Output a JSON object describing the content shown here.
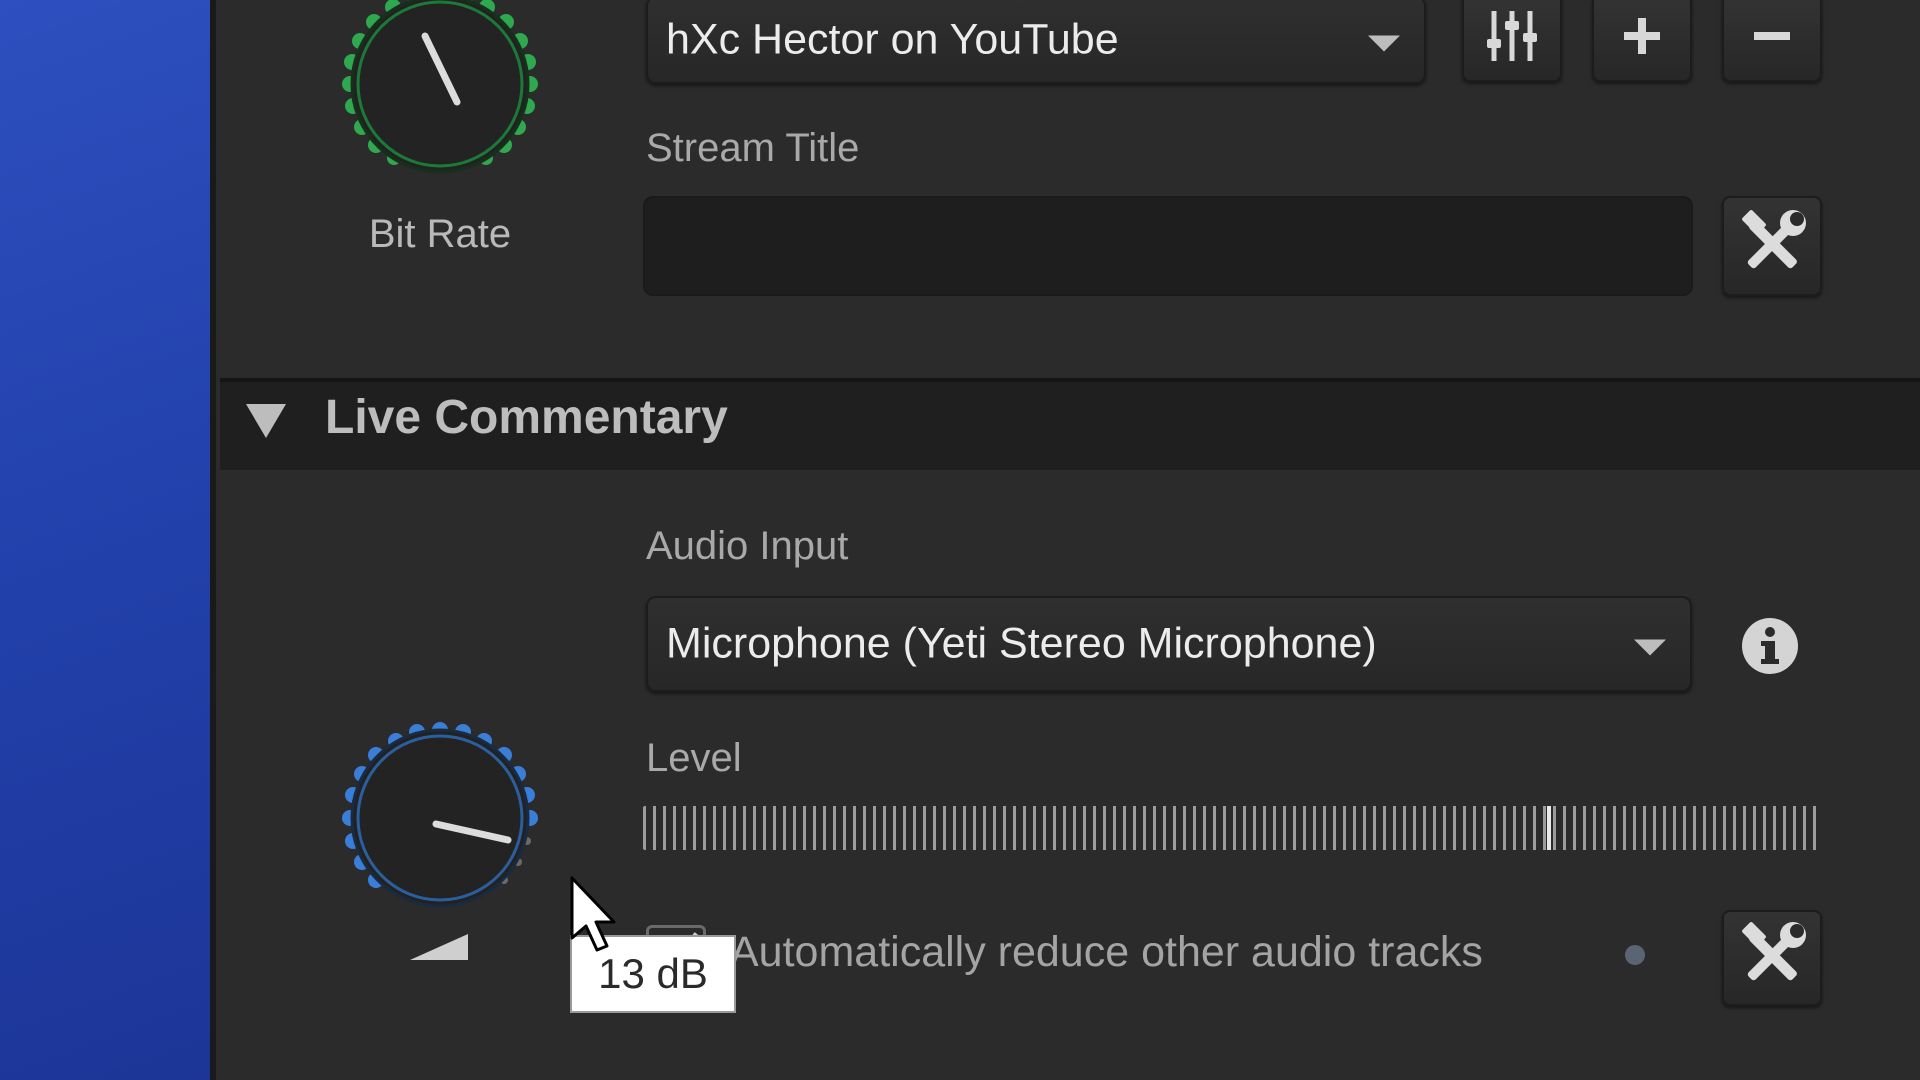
{
  "stream": {
    "knob_label": "Bit Rate",
    "account_selected": "hXc Hector on YouTube",
    "title_label": "Stream Title",
    "title_value": ""
  },
  "live_commentary": {
    "section_title": "Live Commentary",
    "audio_input_label": "Audio Input",
    "audio_input_selected": "Microphone (Yeti Stereo Microphone)",
    "level_label": "Level",
    "auto_reduce_label": "Automatically reduce other audio tracks",
    "auto_reduce_checked": true
  },
  "tooltip": {
    "text": "13 dB"
  },
  "icons": {
    "mixer": "sliders-icon",
    "add": "plus-icon",
    "remove": "minus-icon",
    "tools": "tools-icon",
    "info": "info-icon",
    "collapse": "triangle-down-icon",
    "cursor": "mouse-pointer-icon"
  },
  "colors": {
    "bitrate_knob_accent": "#2fa84f",
    "volume_knob_accent": "#3a7ed8",
    "panel_bg": "#2b2b2b",
    "desktop_bg": "#2342ad"
  }
}
